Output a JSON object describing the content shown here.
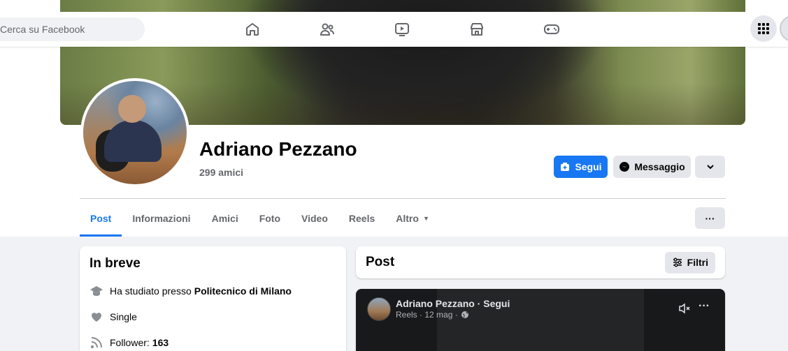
{
  "search": {
    "placeholder": "Cerca su Facebook"
  },
  "nav": {
    "icons": [
      "home-icon",
      "friends-icon",
      "video-icon",
      "marketplace-icon",
      "gaming-icon"
    ],
    "menu_icon": "grid-menu-icon"
  },
  "profile": {
    "name": "Adriano Pezzano",
    "friends": "299 amici"
  },
  "actions": {
    "follow": "Segui",
    "message": "Messaggio"
  },
  "tabs": [
    "Post",
    "Informazioni",
    "Amici",
    "Foto",
    "Video",
    "Reels",
    "Altro"
  ],
  "more_dots": "···",
  "intro": {
    "title": "In breve",
    "studied_prefix": "Ha studiato presso",
    "studied_school": "Politecnico di Milano",
    "relationship": "Single",
    "follower_label": "Follower:",
    "follower_count": "163"
  },
  "posts": {
    "title": "Post",
    "filter": "Filtri"
  },
  "reel": {
    "author": "Adriano Pezzano · Segui",
    "meta": "Reels · 12 mag ·",
    "dots": "···"
  },
  "colors": {
    "primary": "#1877f2",
    "background": "#f0f2f5",
    "secondary_button": "#e4e6eb",
    "muted_text": "#65676b"
  }
}
